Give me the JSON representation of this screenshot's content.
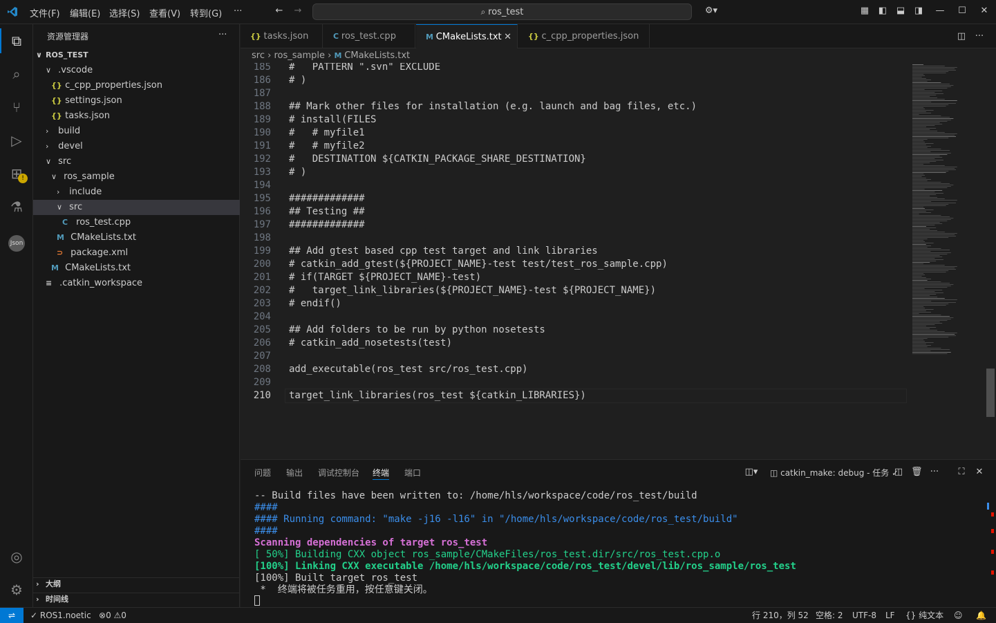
{
  "menu": [
    "文件(F)",
    "编辑(E)",
    "选择(S)",
    "查看(V)",
    "转到(G)",
    "···"
  ],
  "search": {
    "text": "ros_test"
  },
  "sidebar": {
    "title": "资源管理器",
    "more": "···",
    "root": "ROS_TEST",
    "items": [
      {
        "label": ".vscode",
        "icon": "chevron-down",
        "indent": 1
      },
      {
        "label": "c_cpp_properties.json",
        "icon": "{}",
        "indent": 2
      },
      {
        "label": "settings.json",
        "icon": "{}",
        "indent": 2
      },
      {
        "label": "tasks.json",
        "icon": "{}",
        "indent": 2
      },
      {
        "label": "build",
        "icon": "chevron-right",
        "indent": 1
      },
      {
        "label": "devel",
        "icon": "chevron-right",
        "indent": 1
      },
      {
        "label": "src",
        "icon": "chevron-down",
        "indent": 1
      },
      {
        "label": "ros_sample",
        "icon": "chevron-down",
        "indent": 2
      },
      {
        "label": "include",
        "icon": "chevron-right",
        "indent": 3
      },
      {
        "label": "src",
        "icon": "chevron-down",
        "indent": 3
      },
      {
        "label": "ros_test.cpp",
        "icon": "C",
        "indent": 4
      },
      {
        "label": "CMakeLists.txt",
        "icon": "M",
        "indent": 3
      },
      {
        "label": "package.xml",
        "icon": "rss",
        "indent": 3
      },
      {
        "label": "CMakeLists.txt",
        "icon": "M",
        "indent": 2
      },
      {
        "label": ".catkin_workspace",
        "icon": "lines",
        "indent": 1
      }
    ],
    "outline": "大纲",
    "timeline": "时间线"
  },
  "tabs": [
    {
      "label": "tasks.json",
      "icon": "{}"
    },
    {
      "label": "ros_test.cpp",
      "icon": "C"
    },
    {
      "label": "CMakeLists.txt",
      "icon": "M",
      "active": true
    },
    {
      "label": "c_cpp_properties.json",
      "icon": "{}"
    }
  ],
  "breadcrumb": {
    "a": "src",
    "b": "ros_sample",
    "c": "CMakeLists.txt"
  },
  "code": [
    {
      "n": "185",
      "t": "#   PATTERN \".svn\" EXCLUDE"
    },
    {
      "n": "186",
      "t": "# )"
    },
    {
      "n": "187",
      "t": ""
    },
    {
      "n": "188",
      "t": "## Mark other files for installation (e.g. launch and bag files, etc.)"
    },
    {
      "n": "189",
      "t": "# install(FILES"
    },
    {
      "n": "190",
      "t": "#   # myfile1"
    },
    {
      "n": "191",
      "t": "#   # myfile2"
    },
    {
      "n": "192",
      "t": "#   DESTINATION ${CATKIN_PACKAGE_SHARE_DESTINATION}"
    },
    {
      "n": "193",
      "t": "# )"
    },
    {
      "n": "194",
      "t": ""
    },
    {
      "n": "195",
      "t": "#############"
    },
    {
      "n": "196",
      "t": "## Testing ##"
    },
    {
      "n": "197",
      "t": "#############"
    },
    {
      "n": "198",
      "t": ""
    },
    {
      "n": "199",
      "t": "## Add gtest based cpp test target and link libraries"
    },
    {
      "n": "200",
      "t": "# catkin_add_gtest(${PROJECT_NAME}-test test/test_ros_sample.cpp)"
    },
    {
      "n": "201",
      "t": "# if(TARGET ${PROJECT_NAME}-test)"
    },
    {
      "n": "202",
      "t": "#   target_link_libraries(${PROJECT_NAME}-test ${PROJECT_NAME})"
    },
    {
      "n": "203",
      "t": "# endif()"
    },
    {
      "n": "204",
      "t": ""
    },
    {
      "n": "205",
      "t": "## Add folders to be run by python nosetests"
    },
    {
      "n": "206",
      "t": "# catkin_add_nosetests(test)"
    },
    {
      "n": "207",
      "t": ""
    },
    {
      "n": "208",
      "t": "add_executable(ros_test src/ros_test.cpp)"
    },
    {
      "n": "209",
      "t": ""
    },
    {
      "n": "210",
      "t": "target_link_libraries(ros_test ${catkin_LIBRARIES})"
    }
  ],
  "panel": {
    "tabs": [
      "问题",
      "输出",
      "调试控制台",
      "终端",
      "端口"
    ],
    "active": "终端",
    "task": "catkin_make: debug - 任务",
    "terminal": [
      {
        "t": "-- Build files have been written to: /home/hls/workspace/code/ros_test/build",
        "c": "#cccccc"
      },
      {
        "t": "####",
        "c": "#3b8eea"
      },
      {
        "t": "#### Running command: \"make -j16 -l16\" in \"/home/hls/workspace/code/ros_test/build\"",
        "c": "#3b8eea"
      },
      {
        "t": "####",
        "c": "#3b8eea"
      },
      {
        "t": "Scanning dependencies of target ros_test",
        "c": "#d670d6"
      },
      {
        "t": "[ 50%] Building CXX object ros_sample/CMakeFiles/ros_test.dir/src/ros_test.cpp.o",
        "c": "#23d18b"
      },
      {
        "t": "[100%] Linking CXX executable /home/hls/workspace/code/ros_test/devel/lib/ros_sample/ros_test",
        "c": "#23d18b"
      },
      {
        "t": "[100%] Built target ros_test",
        "c": "#cccccc"
      },
      {
        "t": " *  终端将被任务重用，按任意键关闭。",
        "c": "#cccccc"
      }
    ]
  },
  "status": {
    "ros": "ROS1.noetic",
    "errors": "0",
    "warnings": "0",
    "position": "行 210，列 52",
    "spaces": "空格: 2",
    "encoding": "UTF-8",
    "eol": "LF",
    "lang": "{} 纯文本"
  },
  "colors": {
    "accent": "#0078d4",
    "bg": "#1f1f1f",
    "side": "#181818"
  }
}
